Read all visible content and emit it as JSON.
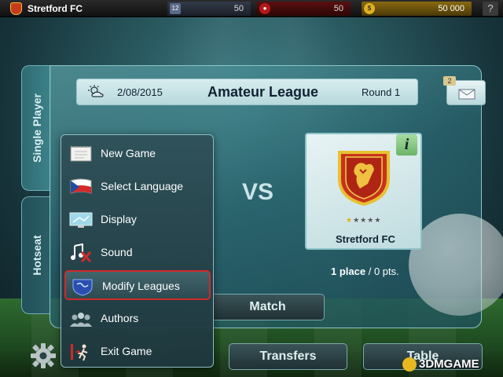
{
  "topbar": {
    "club_name": "Stretford FC",
    "stats": [
      {
        "icon": "shirt-number-icon",
        "icon_text": "12",
        "value": "50"
      },
      {
        "icon": "football-icon",
        "icon_text": "",
        "value": "50"
      },
      {
        "icon": "coin-icon",
        "icon_text": "$",
        "value": "50 000"
      }
    ],
    "help_label": "?"
  },
  "tabs": {
    "single_player": "Single Player",
    "hotseat": "Hotseat"
  },
  "header": {
    "date": "2/08/2015",
    "league": "Amateur League",
    "round": "Round 1",
    "mail_count": "2"
  },
  "match": {
    "vs": "VS",
    "club_name": "Stretford FC",
    "info_label": "i",
    "rating_stars": 1,
    "rating_max": 5,
    "standing_place": "1 place",
    "standing_sep": " / ",
    "standing_points": "0 pts."
  },
  "buttons": {
    "match": "Match",
    "transfers": "Transfers",
    "table": "Table"
  },
  "menu": {
    "items": [
      {
        "label": "New Game",
        "icon": "notepad-icon"
      },
      {
        "label": "Select Language",
        "icon": "flag-icon"
      },
      {
        "label": "Display",
        "icon": "display-icon"
      },
      {
        "label": "Sound",
        "icon": "music-note-muted-icon"
      },
      {
        "label": "Modify Leagues",
        "icon": "league-map-icon",
        "selected": true
      },
      {
        "label": "Authors",
        "icon": "people-icon"
      },
      {
        "label": "Exit Game",
        "icon": "exit-door-icon"
      }
    ]
  },
  "watermark": "3DMGAME",
  "colors": {
    "accent_teal": "#3d8289",
    "highlight_red": "#d02a2a",
    "coin_gold": "#e0b020",
    "crest_red": "#c93a1a"
  }
}
